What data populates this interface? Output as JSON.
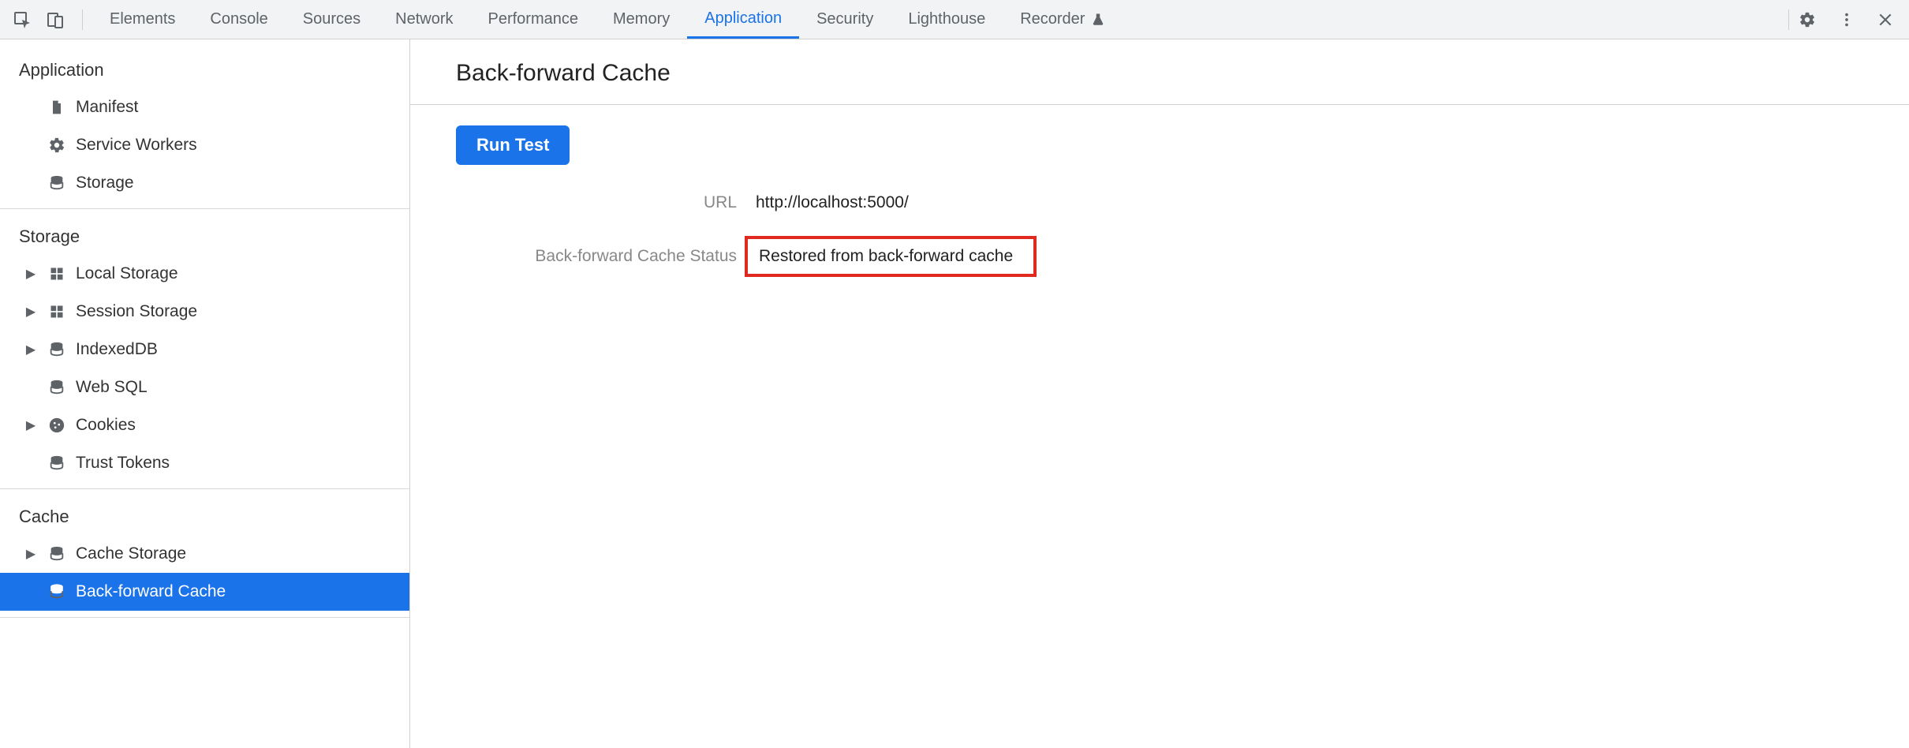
{
  "tabs": [
    {
      "label": "Elements"
    },
    {
      "label": "Console"
    },
    {
      "label": "Sources"
    },
    {
      "label": "Network"
    },
    {
      "label": "Performance"
    },
    {
      "label": "Memory"
    },
    {
      "label": "Application",
      "active": true
    },
    {
      "label": "Security"
    },
    {
      "label": "Lighthouse"
    },
    {
      "label": "Recorder",
      "flask": true
    }
  ],
  "sidebar": {
    "groups": [
      {
        "title": "Application",
        "items": [
          {
            "icon": "file",
            "label": "Manifest"
          },
          {
            "icon": "gear",
            "label": "Service Workers"
          },
          {
            "icon": "db",
            "label": "Storage"
          }
        ]
      },
      {
        "title": "Storage",
        "items": [
          {
            "icon": "grid",
            "label": "Local Storage",
            "expandable": true
          },
          {
            "icon": "grid",
            "label": "Session Storage",
            "expandable": true
          },
          {
            "icon": "db",
            "label": "IndexedDB",
            "expandable": true
          },
          {
            "icon": "db",
            "label": "Web SQL"
          },
          {
            "icon": "cookie",
            "label": "Cookies",
            "expandable": true
          },
          {
            "icon": "db",
            "label": "Trust Tokens"
          }
        ]
      },
      {
        "title": "Cache",
        "items": [
          {
            "icon": "db",
            "label": "Cache Storage",
            "expandable": true
          },
          {
            "icon": "db",
            "label": "Back-forward Cache",
            "selected": true
          }
        ]
      }
    ]
  },
  "panel": {
    "title": "Back-forward Cache",
    "run_label": "Run Test",
    "rows": [
      {
        "label": "URL",
        "value": "http://localhost:5000/"
      },
      {
        "label": "Back-forward Cache Status",
        "value": "Restored from back-forward cache",
        "highlight": true
      }
    ]
  }
}
